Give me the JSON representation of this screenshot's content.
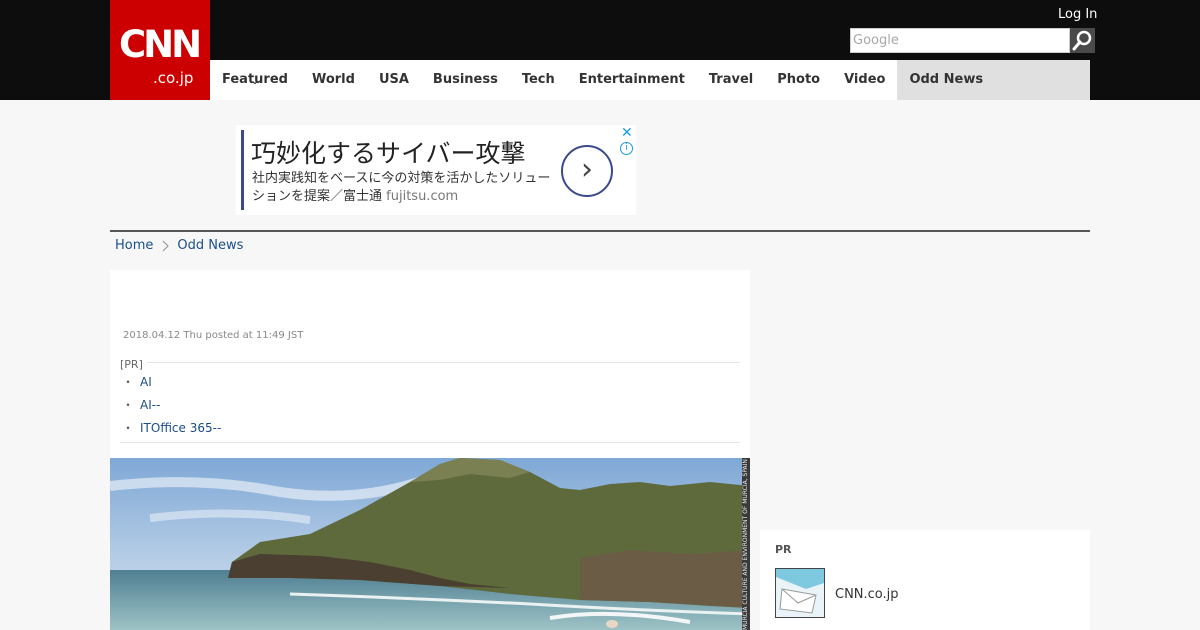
{
  "header": {
    "logo_main": "CNN",
    "logo_sub": ".co.jp",
    "login_label": "Log In",
    "search_placeholder": "Google",
    "icons": {
      "search": "search-icon"
    },
    "colors": {
      "logo_bg": "#cc0000",
      "topbar_bg": "#0d0d0d"
    }
  },
  "nav": {
    "items": [
      {
        "label": "Featured",
        "has_dropdown": true
      },
      {
        "label": "World"
      },
      {
        "label": "USA"
      },
      {
        "label": "Business"
      },
      {
        "label": "Tech"
      },
      {
        "label": "Entertainment"
      },
      {
        "label": "Travel"
      },
      {
        "label": "Photo"
      },
      {
        "label": "Video"
      },
      {
        "label": "Odd News",
        "active": true
      }
    ]
  },
  "ad": {
    "title": "巧妙化するサイバー攻撃",
    "description": "社内実践知をベースに今の対策を活かしたソリューションを提案／富士通",
    "domain": "fujitsu.com",
    "close_symbol": "✕",
    "info_symbol": "i",
    "arrow_symbol": "›"
  },
  "breadcrumb": {
    "home": "Home",
    "current": "Odd News"
  },
  "article": {
    "posted": "2018.04.12 Thu posted at 11:49 JST",
    "pr_label": "[PR]",
    "pr_links": [
      "AI",
      "AI--",
      "ITOffice 365--"
    ],
    "pr_bullet": "・",
    "photo_credit": "MURCIA CULTURE AND ENVIRONMENT OF MURCIA, SPAIN"
  },
  "sidebar": {
    "pr_label": "PR",
    "item_text": "CNN.co.jp"
  }
}
